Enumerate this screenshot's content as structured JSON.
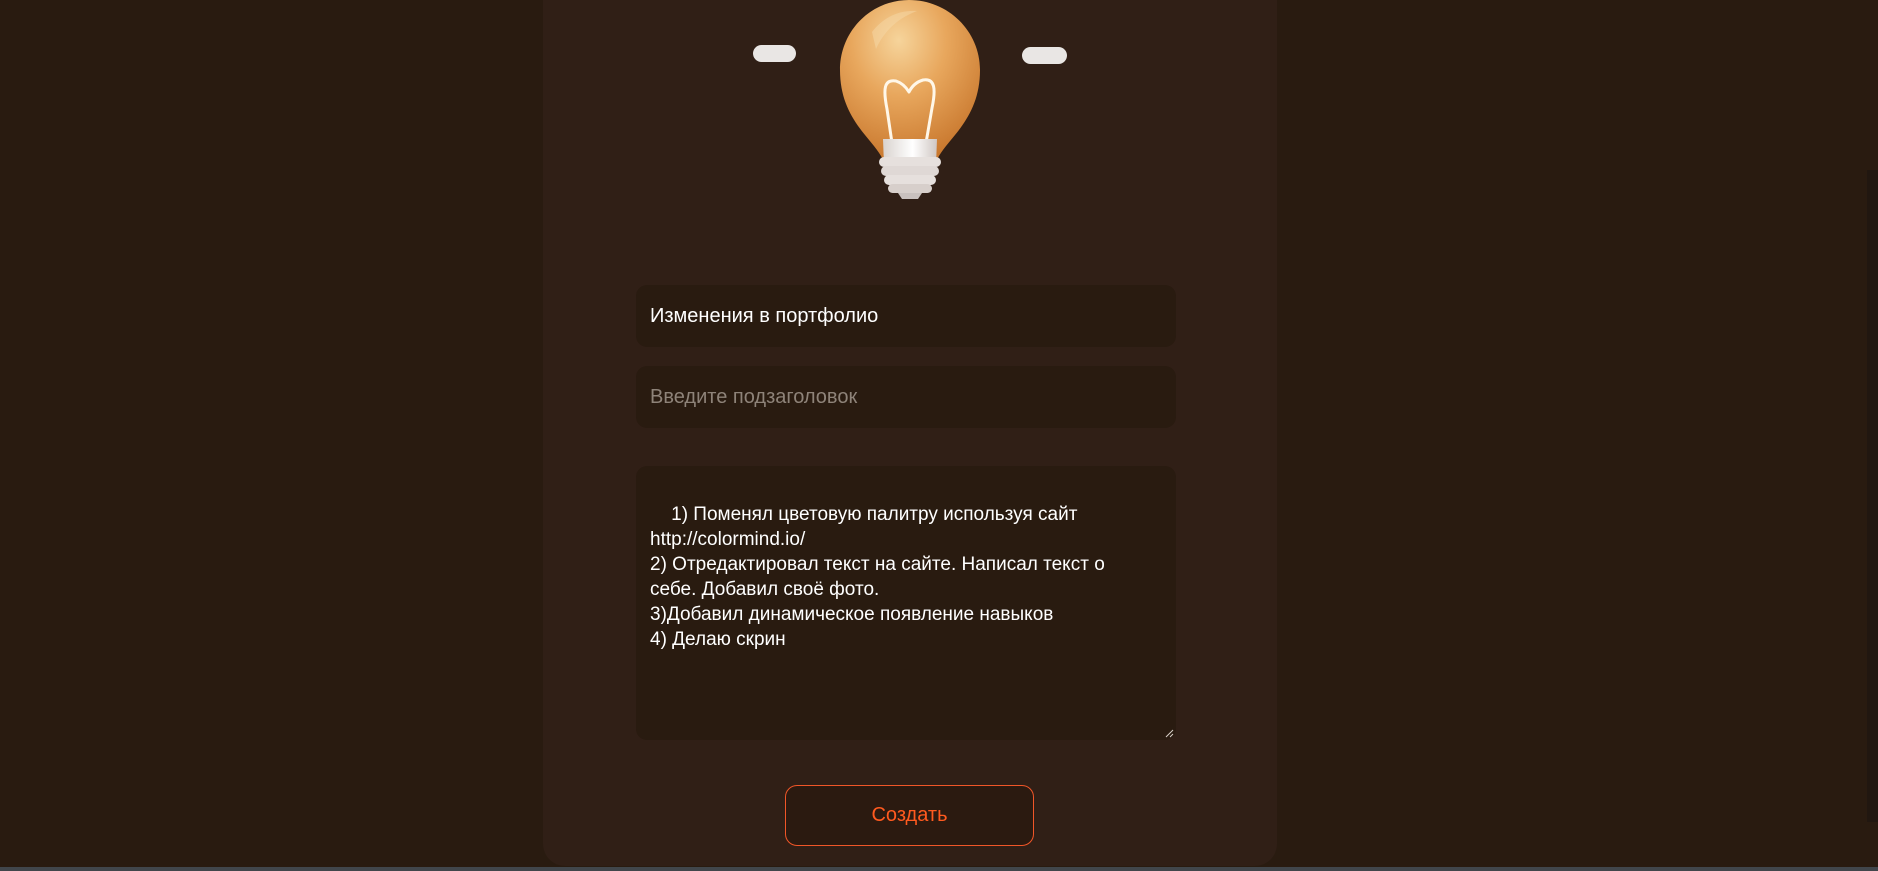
{
  "form": {
    "title_value": "Изменения в портфолио",
    "subtitle_placeholder": "Введите подзаголовок",
    "body_value": "1) Поменял цветовую палитру используя сайт\nhttp://colormind.io/\n2) Отредактировал текст на сайте. Написал текст о\nсебе. Добавил своё фото.\n3)Добавил динамическое появление навыков\n4) Делаю скрин",
    "create_label": "Создать"
  },
  "illustration": {
    "icon": "lightbulb-icon"
  },
  "colors": {
    "page_background": "#291b10",
    "card_background": "#301f16",
    "field_background": "#291b10",
    "accent": "#ff5a1f"
  }
}
